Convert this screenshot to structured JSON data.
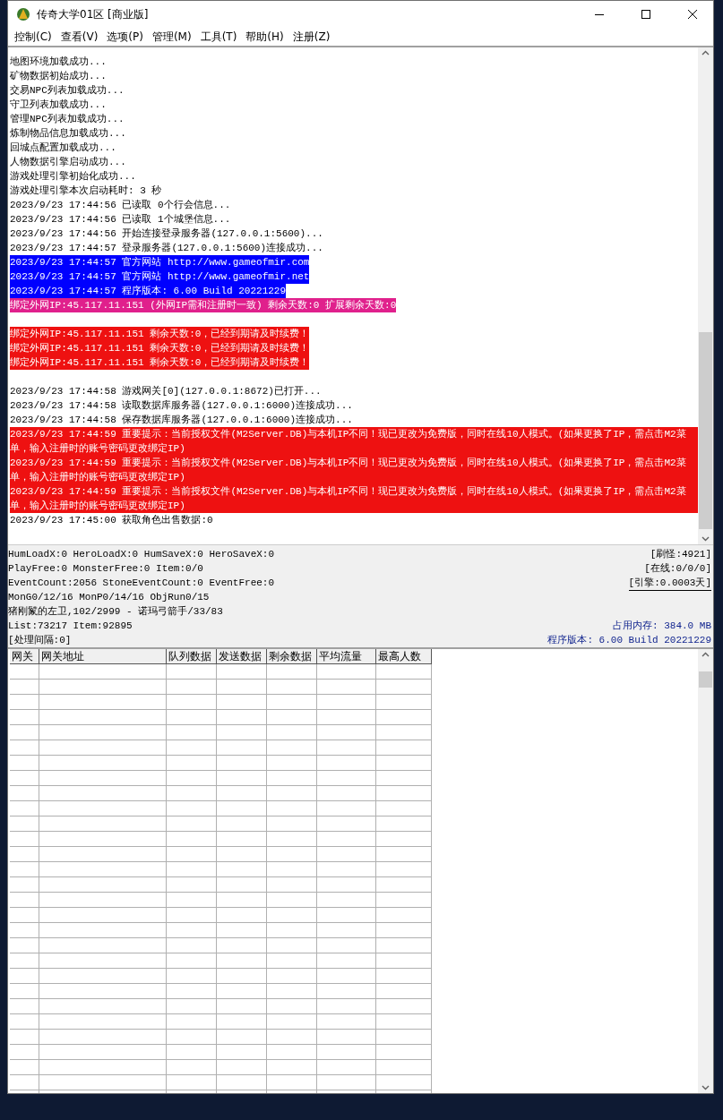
{
  "window": {
    "title": "传奇大学01区 [商业版]"
  },
  "menu": [
    "控制(C)",
    "查看(V)",
    "选项(P)",
    "管理(M)",
    "工具(T)",
    "帮助(H)",
    "注册(Z)"
  ],
  "log": [
    {
      "kind": "text",
      "text": "地图环境加载成功..."
    },
    {
      "kind": "text",
      "text": "矿物数据初始成功..."
    },
    {
      "kind": "text",
      "text": "交易NPC列表加载成功..."
    },
    {
      "kind": "text",
      "text": "守卫列表加载成功..."
    },
    {
      "kind": "text",
      "text": "管理NPC列表加载成功..."
    },
    {
      "kind": "text",
      "text": "炼制物品信息加载成功..."
    },
    {
      "kind": "text",
      "text": "回城点配置加载成功..."
    },
    {
      "kind": "text",
      "text": "人物数据引擎启动成功..."
    },
    {
      "kind": "text",
      "text": "游戏处理引擎初始化成功..."
    },
    {
      "kind": "text",
      "text": "游戏处理引擎本次启动耗时: 3 秒"
    },
    {
      "kind": "text",
      "text": "2023/9/23 17:44:56 已读取 0个行会信息..."
    },
    {
      "kind": "text",
      "text": "2023/9/23 17:44:56 已读取 1个城堡信息..."
    },
    {
      "kind": "text",
      "text": "2023/9/23 17:44:56 开始连接登录服务器(127.0.0.1:5600)..."
    },
    {
      "kind": "text",
      "text": "2023/9/23 17:44:57 登录服务器(127.0.0.1:5600)连接成功..."
    },
    {
      "kind": "text",
      "text": "2023/9/23 17:44:57 官方网站 http://www.gameofmir.com",
      "color": "#0000ff"
    },
    {
      "kind": "text",
      "text": "2023/9/23 17:44:57 官方网站 http://www.gameofmir.net",
      "color": "#0000ff"
    },
    {
      "kind": "text",
      "text": "2023/9/23 17:44:57 程序版本: 6.00 Build 20221229",
      "color": "#0000ff"
    },
    {
      "kind": "text",
      "text": "绑定外网IP:45.117.11.151 (外网IP需和注册时一致) 剩余天数:0 扩展剩余天数:0",
      "color": "#e0208c"
    },
    {
      "kind": "blank"
    },
    {
      "kind": "text",
      "text": "绑定外网IP:45.117.11.151 剩余天数:0，已经到期请及时续费！",
      "color": "#ee1111"
    },
    {
      "kind": "text",
      "text": "绑定外网IP:45.117.11.151 剩余天数:0，已经到期请及时续费！",
      "color": "#ee1111"
    },
    {
      "kind": "text",
      "text": "绑定外网IP:45.117.11.151 剩余天数:0，已经到期请及时续费！",
      "color": "#ee1111"
    },
    {
      "kind": "blank"
    },
    {
      "kind": "text",
      "text": "2023/9/23 17:44:58 游戏网关[0](127.0.0.1:8672)已打开..."
    },
    {
      "kind": "text",
      "text": "2023/9/23 17:44:58 读取数据库服务器(127.0.0.1:6000)连接成功..."
    },
    {
      "kind": "text",
      "text": "2023/9/23 17:44:58 保存数据库服务器(127.0.0.1:6000)连接成功..."
    },
    {
      "kind": "text",
      "text": "2023/9/23 17:44:59 重要提示：当前授权文件(M2Server.DB)与本机IP不同！现已更改为免费版，同时在线10人模式。(如果更换了IP，需点击M2菜单，输入注册时的账号密码更改绑定IP)",
      "color": "#ee1111"
    },
    {
      "kind": "text",
      "text": "2023/9/23 17:44:59 重要提示：当前授权文件(M2Server.DB)与本机IP不同！现已更改为免费版，同时在线10人模式。(如果更换了IP，需点击M2菜单，输入注册时的账号密码更改绑定IP)",
      "color": "#ee1111"
    },
    {
      "kind": "text",
      "text": "2023/9/23 17:44:59 重要提示：当前授权文件(M2Server.DB)与本机IP不同！现已更改为免费版，同时在线10人模式。(如果更换了IP，需点击M2菜单，输入注册时的账号密码更改绑定IP)",
      "color": "#ee1111"
    },
    {
      "kind": "text",
      "text": "2023/9/23 17:45:00 获取角色出售数据:0"
    }
  ],
  "status": {
    "left": [
      "HumLoadX:0 HeroLoadX:0 HumSaveX:0 HeroSaveX:0",
      "PlayFree:0 MonsterFree:0 Item:0/0",
      "EventCount:2056 StoneEventCount:0 EventFree:0",
      "MonG0/12/16 MonP0/14/16 ObjRun0/15",
      "猪刚鬣的左卫,102/2999 - 诺玛弓箭手/33/83",
      "List:73217 Item:92895",
      "[处理间隔:0]"
    ],
    "right_top": [
      {
        "kind": "plain",
        "text": "[刷怪:4921]"
      },
      {
        "kind": "plain",
        "text": "[在线:0/0/0]"
      },
      {
        "kind": "sunken",
        "text": "[引擎:0.0003天]"
      }
    ],
    "right_bottom": [
      "占用内存: 384.0 MB",
      "程序版本: 6.00 Build 20221229"
    ]
  },
  "table": {
    "columns": [
      "网关",
      "网关地址",
      "队列数据",
      "发送数据",
      "剩余数据",
      "平均流量",
      "最高人数"
    ]
  }
}
